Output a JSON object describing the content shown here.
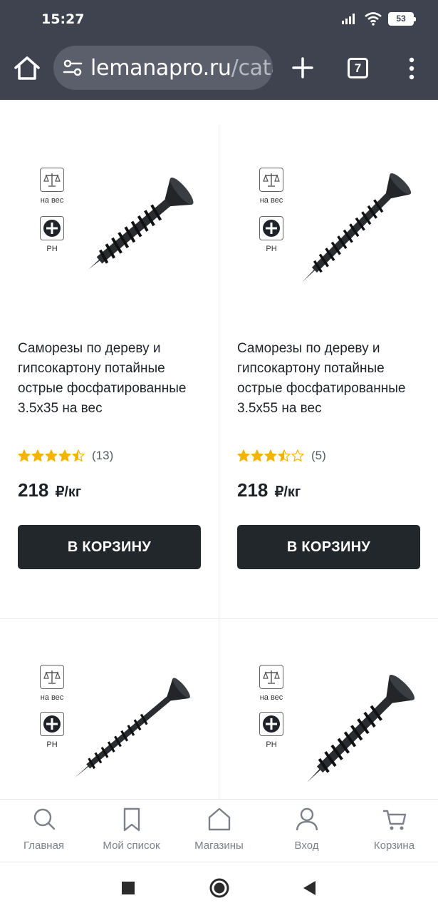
{
  "status_bar": {
    "time": "15:27",
    "battery": "53",
    "icons": [
      "signal-icon",
      "wifi-icon",
      "battery-icon"
    ]
  },
  "browser": {
    "url_main": "lemanapro.ru",
    "url_rest": "/cata",
    "tab_count": "7"
  },
  "products": [
    {
      "title": "Саморезы по дереву и гипсокартону потайные острые фосфатированные 3.5х35 на вес",
      "rating": 4.5,
      "reviews": "(13)",
      "price": "218",
      "unit": "₽/кг",
      "badge_weight": "на вес",
      "badge_head": "PH",
      "button": "В КОРЗИНУ"
    },
    {
      "title": "Саморезы по дереву и гипсокартону потайные острые фосфатированные 3.5х55 на вес",
      "rating": 3.5,
      "reviews": "(5)",
      "price": "218",
      "unit": "₽/кг",
      "badge_weight": "на вес",
      "badge_head": "PH",
      "button": "В КОРЗИНУ"
    },
    {
      "badge_weight": "на вес",
      "badge_head": "PH"
    },
    {
      "badge_weight": "на вес",
      "badge_head": "PH"
    }
  ],
  "bottom_nav": [
    {
      "label": "Главная",
      "icon": "search-icon"
    },
    {
      "label": "Мой список",
      "icon": "bookmark-icon"
    },
    {
      "label": "Магазины",
      "icon": "store-icon"
    },
    {
      "label": "Вход",
      "icon": "user-icon"
    },
    {
      "label": "Корзина",
      "icon": "cart-icon"
    }
  ],
  "colors": {
    "browser_bar": "#3f4350",
    "cart_button": "#21272b",
    "star": "#f5b301"
  }
}
